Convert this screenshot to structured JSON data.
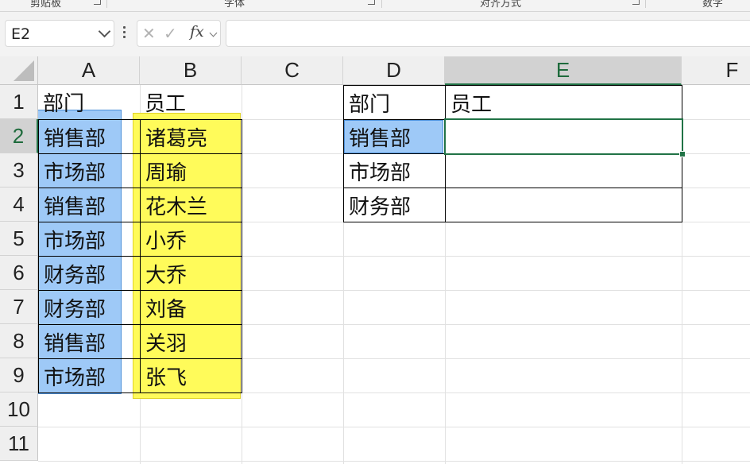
{
  "ribbon": {
    "groups": [
      "剪贴板",
      "字体",
      "对齐方式",
      "数字"
    ]
  },
  "formula_bar": {
    "name_box": "E2",
    "cancel_symbol": "✕",
    "enter_symbol": "✓",
    "fx_label": "fx",
    "formula": ""
  },
  "columns": [
    "A",
    "B",
    "C",
    "D",
    "E",
    "F"
  ],
  "rows": [
    "1",
    "2",
    "3",
    "4",
    "5",
    "6",
    "7",
    "8",
    "9",
    "10",
    "11"
  ],
  "selected_cell": "E2",
  "source_table": {
    "headers": [
      "部门",
      "员工"
    ],
    "records": [
      [
        "销售部",
        "诸葛亮"
      ],
      [
        "市场部",
        "周瑜"
      ],
      [
        "销售部",
        "花木兰"
      ],
      [
        "市场部",
        "小乔"
      ],
      [
        "财务部",
        "大乔"
      ],
      [
        "财务部",
        "刘备"
      ],
      [
        "销售部",
        "关羽"
      ],
      [
        "市场部",
        "张飞"
      ]
    ]
  },
  "lookup_table": {
    "headers": [
      "部门",
      "员工"
    ],
    "departments": [
      "销售部",
      "市场部",
      "财务部"
    ],
    "results": [
      "",
      "",
      ""
    ]
  },
  "colors": {
    "highlight_blue": "#9ec9f7",
    "highlight_yellow": "#fffb5a",
    "selection_green": "#217346"
  }
}
